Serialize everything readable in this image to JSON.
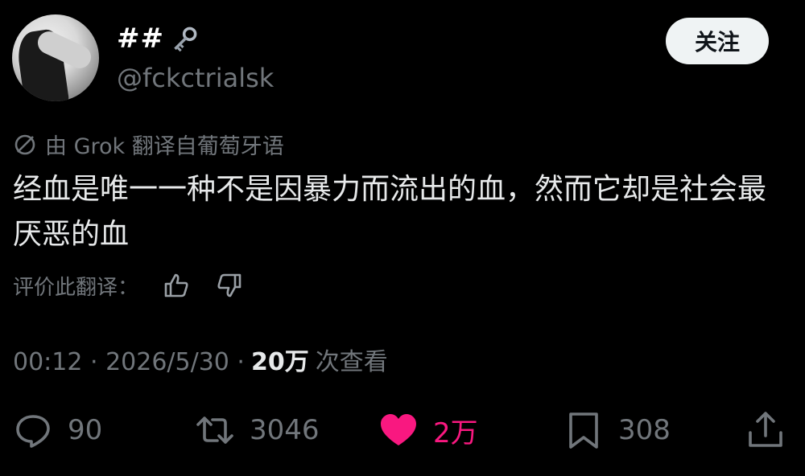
{
  "user": {
    "display_name": "##",
    "handle": "@fckctrialsk",
    "avatar_icon": "avatar-photo",
    "name_emoji": "key-icon"
  },
  "follow_label": "关注",
  "translation_note": "由 Grok 翻译自葡萄牙语",
  "tweet_text": "经血是唯一一种不是因暴力而流出的血，然而它却是社会最厌恶的血",
  "rate_label": "评价此翻译：",
  "meta": {
    "time": "00:12 · 2026/5/30 ·",
    "views_count": "20万",
    "views_label": "次查看"
  },
  "actions": {
    "replies": "90",
    "retweets": "3046",
    "likes": "2万",
    "bookmarks": "308"
  },
  "colors": {
    "background": "#000000",
    "text": "#e7e9ea",
    "muted": "#71767b",
    "like": "#f91880",
    "button_bg": "#eff3f4"
  }
}
